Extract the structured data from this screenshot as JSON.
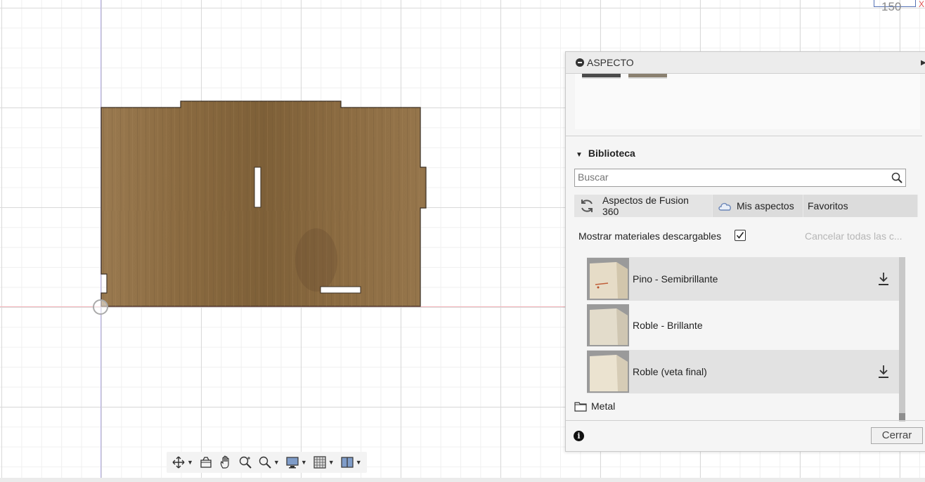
{
  "ruler": {
    "value": "150",
    "axis_letter": "X"
  },
  "panel": {
    "title": "ASPECTO",
    "library": {
      "header": "Biblioteca",
      "search": {
        "placeholder": "Buscar",
        "value": ""
      },
      "tabs": [
        {
          "label": "Aspectos de Fusion 360",
          "icon": "refresh-icon"
        },
        {
          "label": "Mis aspectos",
          "icon": "cloud-icon"
        },
        {
          "label": "Favoritos"
        }
      ],
      "show_downloadable": {
        "label": "Mostrar materiales descargables",
        "checked": true
      },
      "cancel_all": "Cancelar todas las c...",
      "materials": [
        {
          "name": "Pino - Semibrillante",
          "downloadable": true
        },
        {
          "name": "Roble - Brillante",
          "downloadable": false
        },
        {
          "name": "Roble (veta final)",
          "downloadable": true
        }
      ],
      "folder": {
        "label": "Metal",
        "icon": "folder-icon"
      }
    },
    "footer": {
      "close_label": "Cerrar",
      "info_icon": "info-icon"
    }
  },
  "toolbar": {
    "tools": [
      "orbit-icon",
      "look-at-icon",
      "pan-icon",
      "zoom-icon",
      "zoom-window-icon",
      "display-settings-icon",
      "grid-icon",
      "viewports-icon"
    ]
  },
  "colors": {
    "wood": "#8b6b42",
    "grid_major": "#d9d9d9",
    "grid_minor": "#f0f0f0",
    "axis_x": "#f4b6bc",
    "axis_y": "#b7b0e6"
  }
}
